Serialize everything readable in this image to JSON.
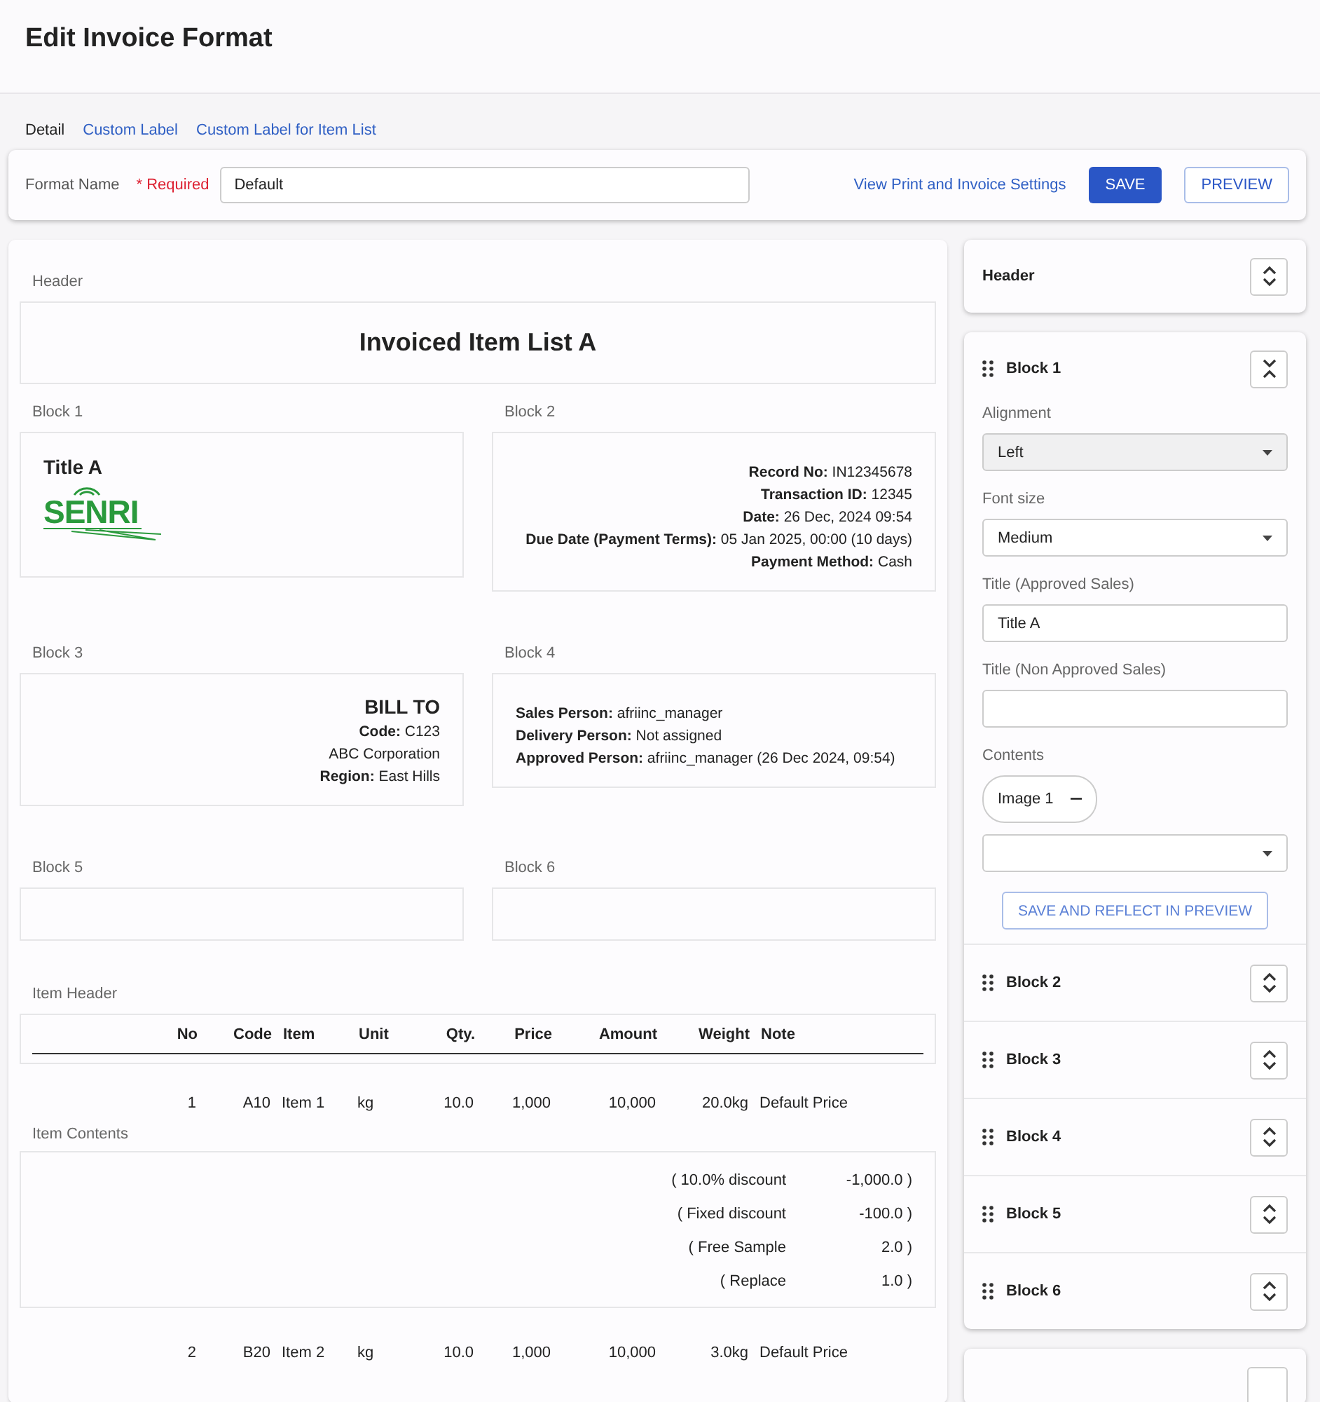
{
  "page_title": "Edit Invoice Format",
  "tabs": [
    {
      "label": "Detail",
      "selected": true
    },
    {
      "label": "Custom Label",
      "selected": false
    },
    {
      "label": "Custom Label for Item List",
      "selected": false
    }
  ],
  "format": {
    "label": "Format Name",
    "required": "* Required",
    "value": "Default",
    "settings_link": "View Print and Invoice Settings",
    "save": "SAVE",
    "preview": "PREVIEW"
  },
  "preview": {
    "header_label": "Header",
    "header_title": "Invoiced Item List A",
    "blocks": [
      {
        "label": "Block 1",
        "kind": "logo",
        "title": "Title A",
        "logo_text": "SENRI"
      },
      {
        "label": "Block 2",
        "kind": "right_lines",
        "lines": [
          "**Record No:** IN12345678",
          "**Transaction ID:** 12345",
          "**Date:** 26 Dec, 2024 09:54",
          "**Due Date (Payment Terms):** 05 Jan 2025, 00:00 (10 days)",
          "**Payment Method:** Cash"
        ]
      },
      {
        "label": "Block 3",
        "kind": "right_lines",
        "title": "BILL TO",
        "lines": [
          "**Code:** C123",
          "ABC Corporation",
          "**Region:** East Hills"
        ]
      },
      {
        "label": "Block 4",
        "kind": "left_lines",
        "lines": [
          "**Sales Person:** afriinc_manager",
          "**Delivery Person:** Not assigned",
          "**Approved Person:** afriinc_manager (26 Dec 2024, 09:54)"
        ]
      },
      {
        "label": "Block 5",
        "kind": "empty"
      },
      {
        "label": "Block 6",
        "kind": "empty"
      }
    ],
    "item_header_label": "Item Header",
    "columns": [
      "No",
      "Code",
      "Item",
      "Unit",
      "Qty.",
      "Price",
      "Amount",
      "Weight",
      "Note"
    ],
    "items": [
      {
        "cells": [
          "1",
          "A10",
          "Item 1",
          "kg",
          "10.0",
          "1,000",
          "10,000",
          "20.0kg",
          "Default Price"
        ],
        "contents_label": "Item Contents",
        "contents": [
          {
            "label": "( 10.0% discount",
            "value": "-1,000.0 )"
          },
          {
            "label": "( Fixed discount",
            "value": "-100.0 )"
          },
          {
            "label": "( Free Sample",
            "value": "2.0 )"
          },
          {
            "label": "( Replace",
            "value": "1.0 )"
          }
        ]
      },
      {
        "cells": [
          "2",
          "B20",
          "Item 2",
          "kg",
          "10.0",
          "1,000",
          "10,000",
          "3.0kg",
          "Default Price"
        ]
      }
    ]
  },
  "sidebar": {
    "header": {
      "title": "Header",
      "expanded": false
    },
    "blocks": [
      {
        "title": "Block 1",
        "expanded": true,
        "fields": [
          {
            "label": "Alignment",
            "kind": "select",
            "value": "Left",
            "hovered": true
          },
          {
            "label": "Font size",
            "kind": "select",
            "value": "Medium",
            "hovered": false
          },
          {
            "label": "Title (Approved Sales)",
            "kind": "text",
            "value": "Title A"
          },
          {
            "label": "Title (Non Approved Sales)",
            "kind": "text"
          },
          {
            "label": "Contents",
            "kind": "chips",
            "chips": [
              "Image 1"
            ]
          }
        ],
        "apply": "SAVE AND REFLECT IN PREVIEW"
      },
      {
        "title": "Block 2",
        "expanded": false
      },
      {
        "title": "Block 3",
        "expanded": false
      },
      {
        "title": "Block 4",
        "expanded": false
      },
      {
        "title": "Block 5",
        "expanded": false
      },
      {
        "title": "Block 6",
        "expanded": false
      }
    ]
  }
}
